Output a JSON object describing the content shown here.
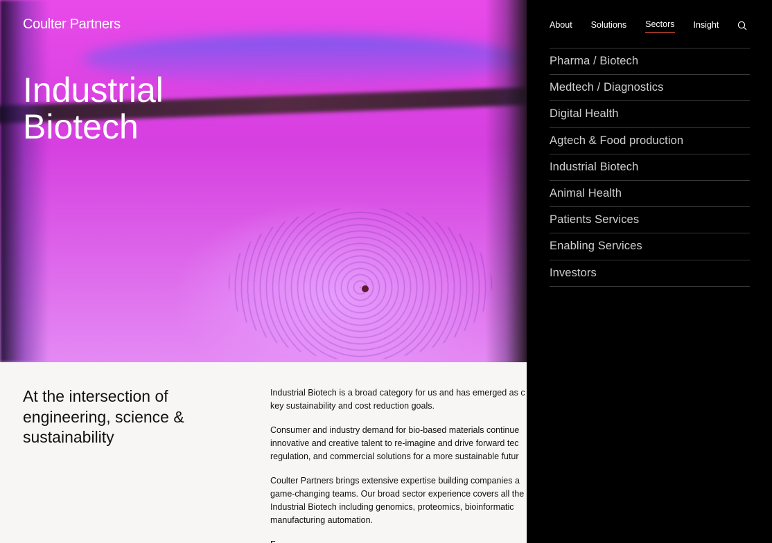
{
  "brand": {
    "name_left": "Coulter",
    "colon": ":",
    "name_right": "Partners"
  },
  "hero": {
    "title_line1": "Industrial",
    "title_line2": "Biotech"
  },
  "intro": "At the intersection of engineering, science & sustainability",
  "body": [
    "Industrial Biotech is a broad category for us and has emerged as c",
    "key sustainability and cost reduction goals.",
    "Consumer and industry demand for bio-based materials continue",
    "innovative and creative talent to re-imagine and drive forward tec",
    "regulation, and commercial solutions for a more sustainable futur",
    "Coulter Partners brings extensive expertise building companies a",
    "game-changing teams. Our broad sector experience covers all the",
    "Industrial Biotech including genomics, proteomics, bioinformatic",
    "manufacturing automation.",
    "F"
  ],
  "nav": {
    "items": [
      "About",
      "Solutions",
      "Sectors",
      "Insight"
    ],
    "active": "Sectors",
    "search_icon": "search-icon"
  },
  "sectors": [
    "Pharma / Biotech",
    "Medtech / Diagnostics",
    "Digital Health",
    "Agtech & Food production",
    "Industrial Biotech",
    "Animal Health",
    "Patients Services",
    "Enabling Services",
    "Investors"
  ],
  "colors": {
    "accent": "#ff5a3c",
    "panel": "#000000",
    "hero": "#e84ae9"
  }
}
